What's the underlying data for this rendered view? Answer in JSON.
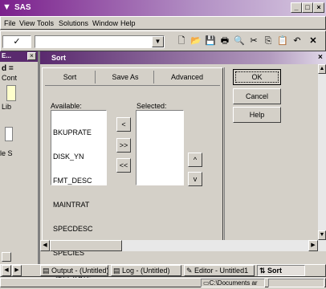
{
  "app": {
    "title": "SAS",
    "window_buttons": [
      "_",
      "□",
      "×"
    ]
  },
  "menu": [
    "File",
    "View",
    "Tools",
    "Solutions",
    "Window",
    "Help"
  ],
  "toolbar": {
    "check_glyph": "✓",
    "command_value": "",
    "icons": [
      "new-icon",
      "open-icon",
      "save-icon",
      "print-icon",
      "preview-icon",
      "cut-icon",
      "copy-icon",
      "paste-icon",
      "undo-icon",
      "close-icon"
    ]
  },
  "side": {
    "title": "E...",
    "close": "×",
    "d_label": "d =",
    "cont": "Cont",
    "lib": "Lib",
    "les": "le S"
  },
  "sort": {
    "title": "Sort",
    "close": "×",
    "tabs": [
      "Sort",
      "Save As",
      "Advanced"
    ],
    "available_label": "Available:",
    "selected_label": "Selected:",
    "available_items": [
      "BKUPRATE",
      "DISK_YN",
      "FMT_DESC",
      "MAINTRAT",
      "SPECDESC",
      "SPECIES",
      "SPECRATE"
    ],
    "selected_items": [],
    "move_buttons": [
      "<",
      ">>",
      "<<"
    ],
    "order_buttons": [
      "^",
      "v"
    ],
    "ok": "OK",
    "cancel": "Cancel",
    "help": "Help"
  },
  "taskbar": {
    "items": [
      {
        "label": "Output - (Untitled)"
      },
      {
        "label": "Log - (Untitled)"
      },
      {
        "label": "Editor - Untitled1"
      },
      {
        "label": "Sort"
      }
    ]
  },
  "status": {
    "path": "C:\\Documents ar"
  }
}
